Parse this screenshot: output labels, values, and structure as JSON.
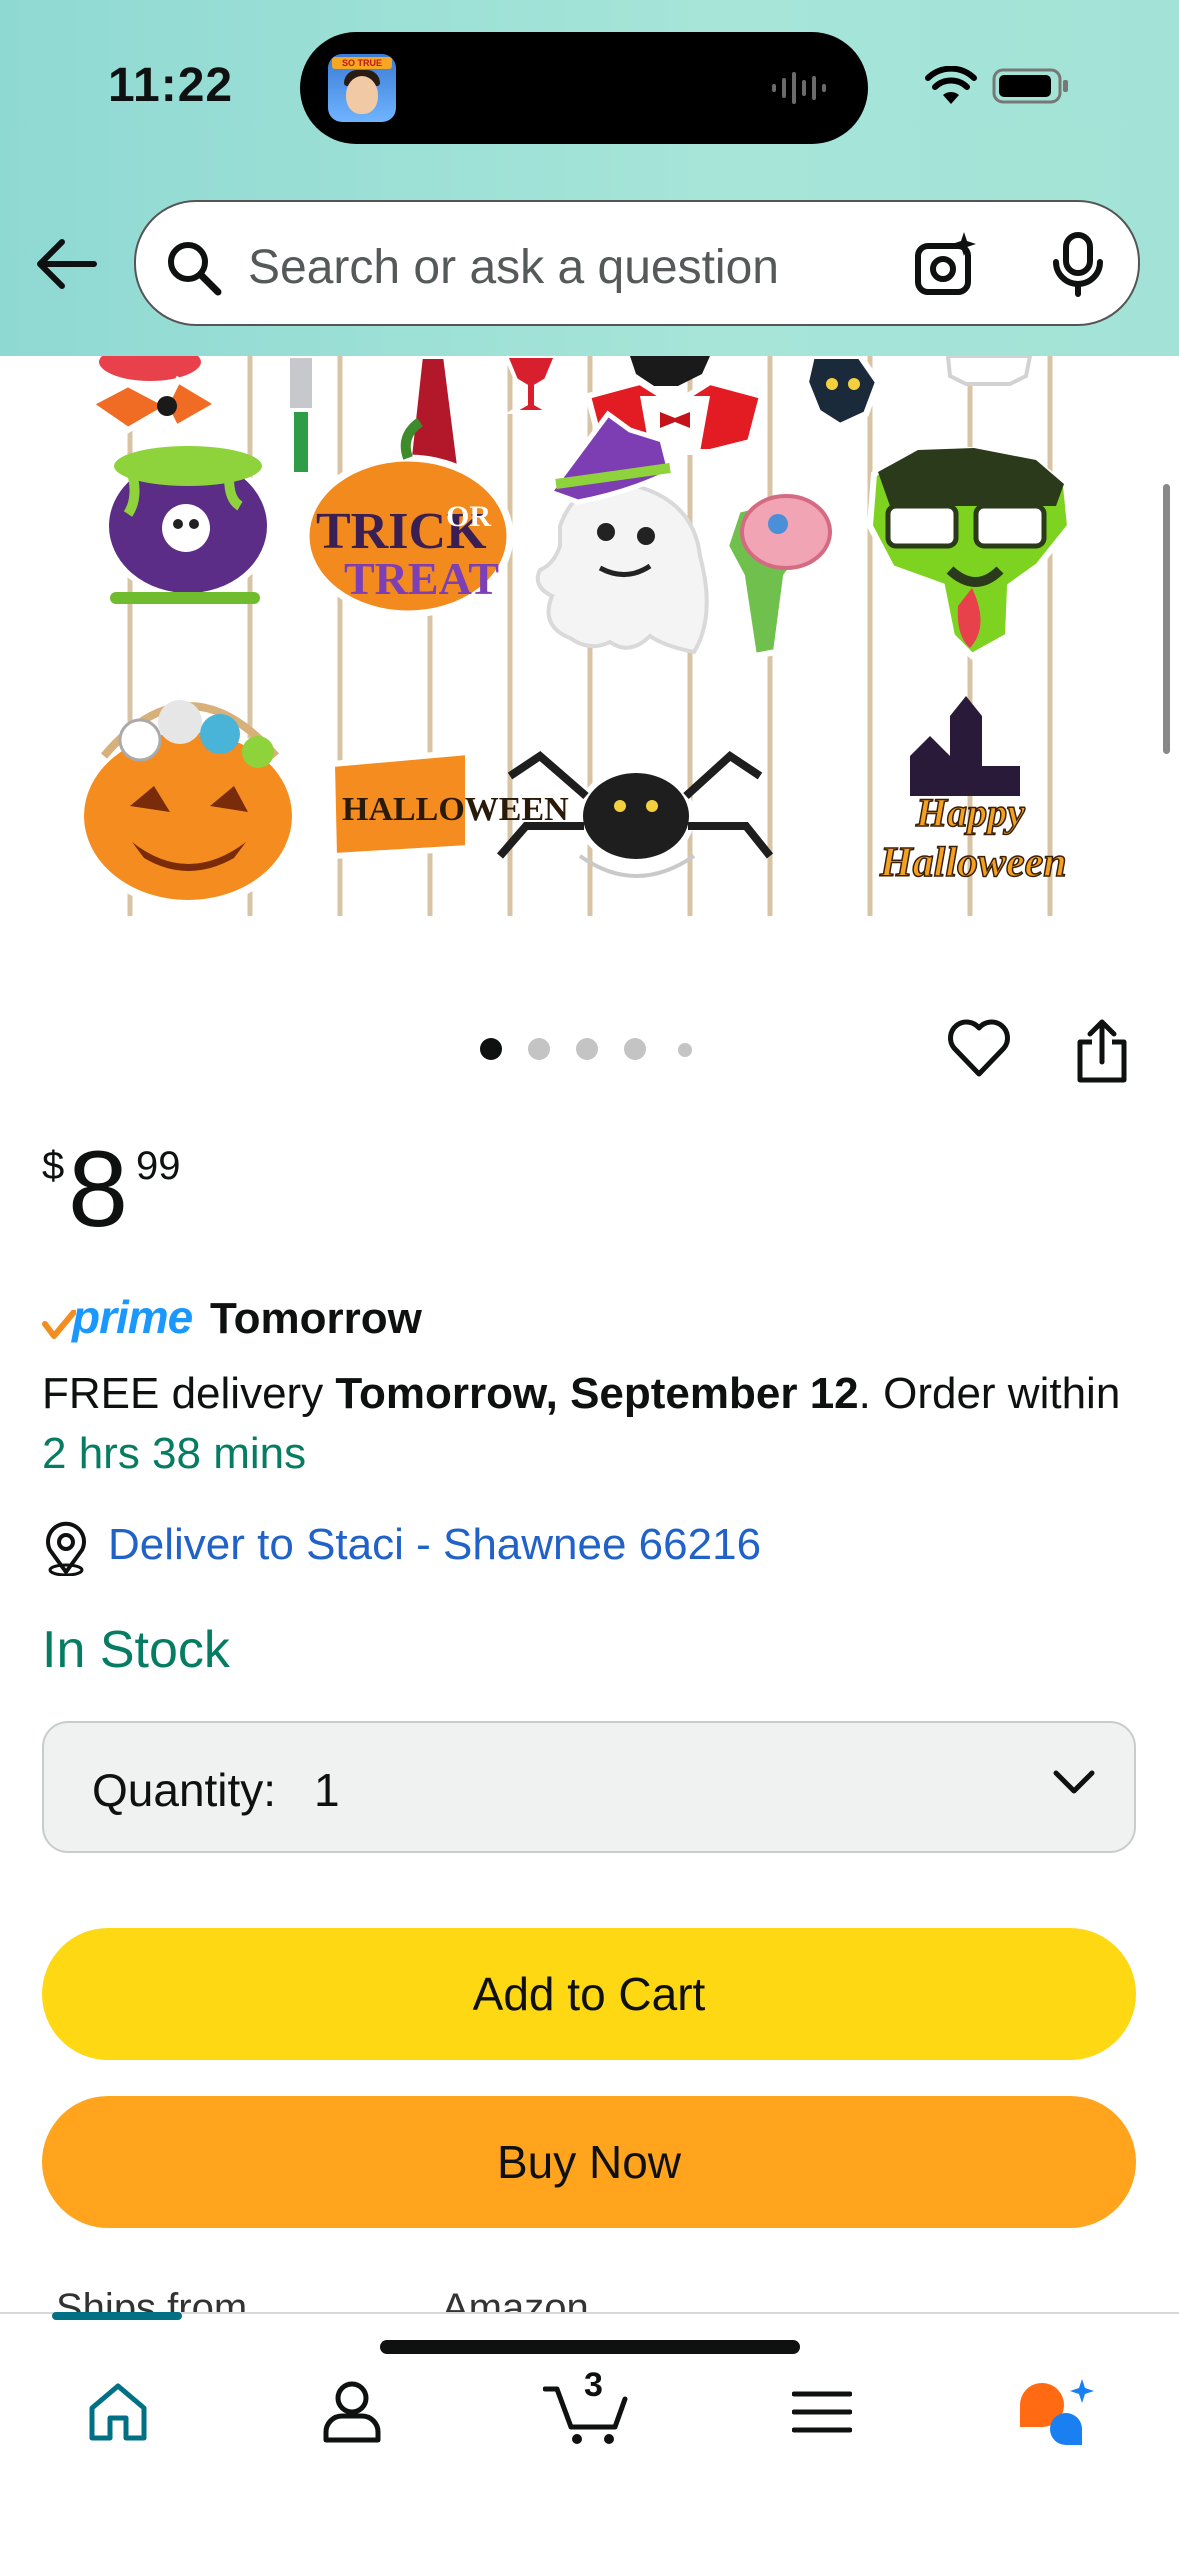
{
  "status_bar": {
    "time": "11:22",
    "island_tag": "SO TRUE"
  },
  "search": {
    "placeholder": "Search or ask a question"
  },
  "gallery": {
    "image_count": 5,
    "active_index": 0
  },
  "product_art": {
    "sign_trick_1": "TRICK",
    "sign_trick_2": "OR",
    "sign_treat": "TREAT",
    "sign_halloween": "HALLOWEEN",
    "sign_happy": "Happy",
    "sign_happy_halloween": "Halloween"
  },
  "price": {
    "symbol": "$",
    "whole": "8",
    "fraction": "99"
  },
  "prime": {
    "logo_text": "prime",
    "day": "Tomorrow"
  },
  "delivery": {
    "prefix": "FREE delivery ",
    "date": "Tomorrow, September 12",
    "suffix": ". Order within ",
    "countdown": "2 hrs 38 mins"
  },
  "location": {
    "link_text": "Deliver to Staci - Shawnee 66216"
  },
  "stock": {
    "status": "In Stock"
  },
  "quantity": {
    "label": "Quantity:",
    "value": "1"
  },
  "buttons": {
    "add_to_cart": "Add to Cart",
    "buy_now": "Buy Now"
  },
  "ships": {
    "label": "Ships from",
    "value": "Amazon"
  },
  "tabbar": {
    "cart_count": "3",
    "active_tab": "home"
  },
  "colors": {
    "header_bg": "#a3e3d7",
    "add_to_cart": "#ffd814",
    "buy_now": "#ffa41c",
    "in_stock": "#067d62",
    "link": "#2162c8",
    "prime": "#1a98ff",
    "tab_active": "#007185"
  }
}
